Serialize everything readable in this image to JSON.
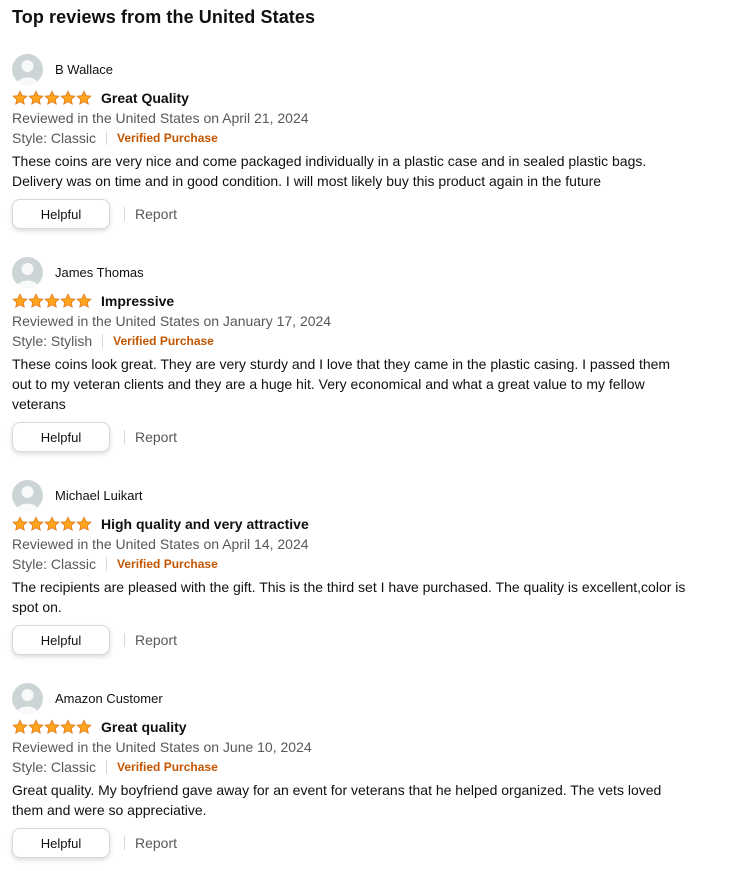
{
  "section": {
    "title": "Top reviews from the United States"
  },
  "reviews": [
    {
      "reviewer": "B Wallace",
      "rating": 5,
      "title": "Great Quality",
      "date_line": "Reviewed in the United States on April 21, 2024",
      "style": "Style: Classic",
      "verified": "Verified Purchase",
      "body": "These coins are very nice and come packaged individually in a plastic case and in sealed plastic bags. Delivery was on time and in good condition. I will most likely buy this product again in the future",
      "helpful_label": "Helpful",
      "report_label": "Report"
    },
    {
      "reviewer": "James Thomas",
      "rating": 5,
      "title": "Impressive",
      "date_line": "Reviewed in the United States on January 17, 2024",
      "style": "Style: Stylish",
      "verified": "Verified Purchase",
      "body": "These coins look great. They are very sturdy and I love that they came in the plastic casing. I passed them out to my veteran clients and they are a huge hit. Very economical and what a great value to my fellow veterans",
      "helpful_label": "Helpful",
      "report_label": "Report"
    },
    {
      "reviewer": "Michael Luikart",
      "rating": 5,
      "title": "High quality and very attractive",
      "date_line": "Reviewed in the United States on April 14, 2024",
      "style": "Style: Classic",
      "verified": "Verified Purchase",
      "body": "The recipients are pleased with the gift. This is the third set I have purchased. The quality is excellent,color is spot on.",
      "helpful_label": "Helpful",
      "report_label": "Report"
    },
    {
      "reviewer": "Amazon Customer",
      "rating": 5,
      "title": "Great quality",
      "date_line": "Reviewed in the United States on June 10, 2024",
      "style": "Style: Classic",
      "verified": "Verified Purchase",
      "body": "Great quality. My boyfriend gave away for an event for veterans that he helped organized. The vets loved them and were so appreciative.",
      "helpful_label": "Helpful",
      "report_label": "Report"
    }
  ],
  "icons": {
    "avatar": "user-avatar-icon",
    "star": "star-icon"
  },
  "colors": {
    "star": "#ffa41c",
    "star_stroke": "#de7921",
    "verified": "#c45500",
    "muted": "#565959"
  }
}
